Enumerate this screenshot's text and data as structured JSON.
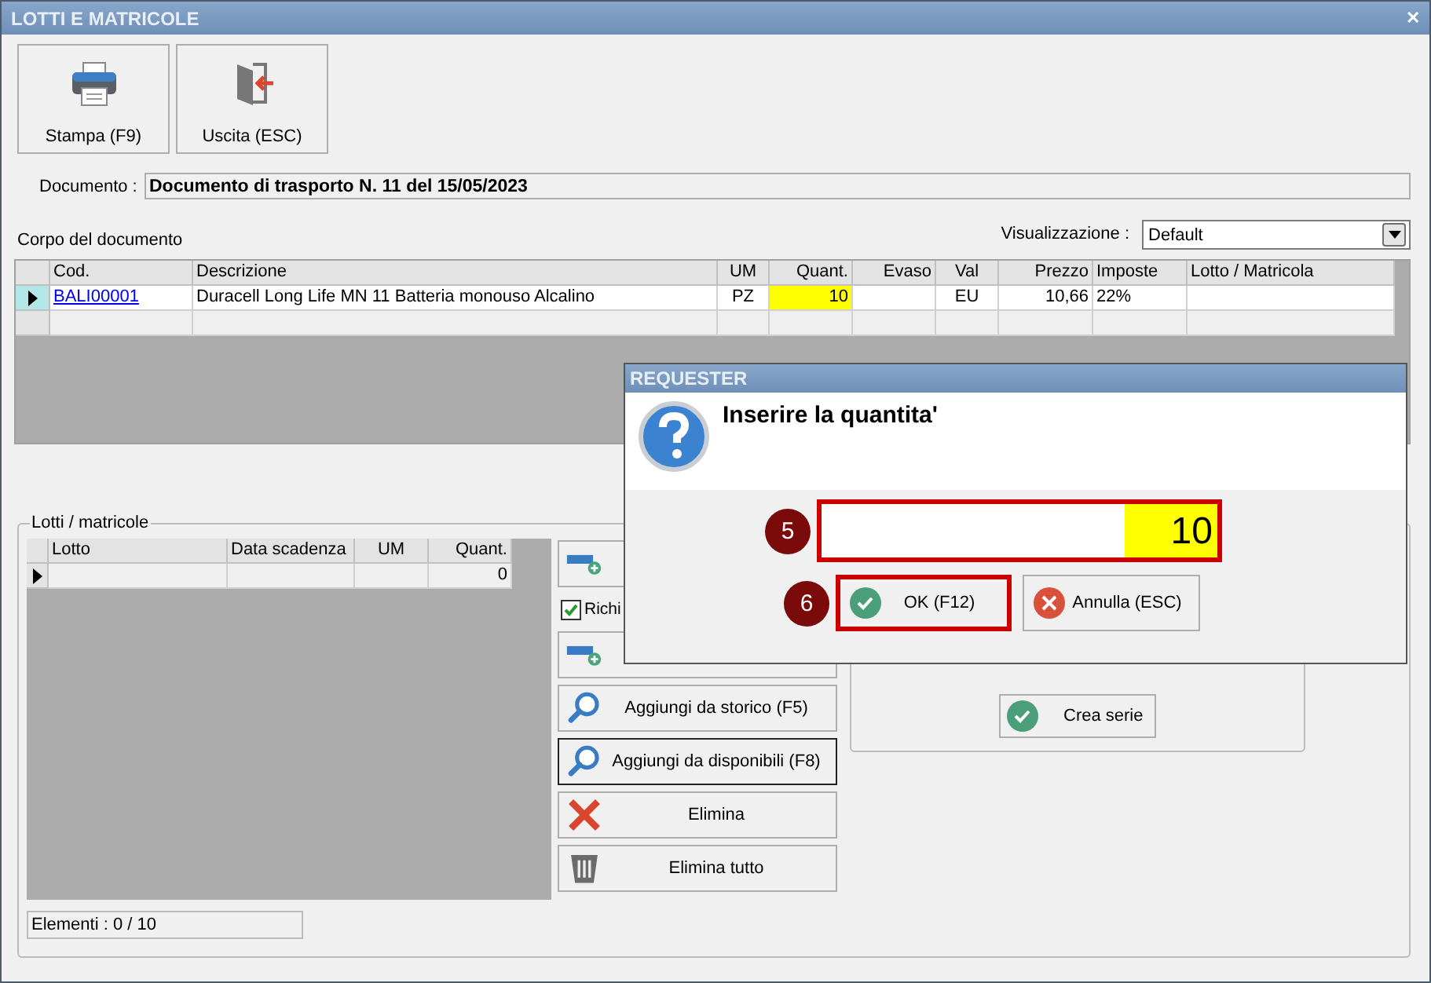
{
  "window": {
    "title": "LOTTI E MATRICOLE",
    "close": "✕"
  },
  "toolbar": [
    {
      "kind": "print",
      "label": "Stampa (F9)"
    },
    {
      "kind": "exit",
      "label": "Uscita (ESC)"
    }
  ],
  "document": {
    "label": "Documento :",
    "value": "Documento di trasporto N. 11 del 15/05/2023"
  },
  "body": {
    "title": "Corpo del documento",
    "view_label": "Visualizzazione :",
    "view_value": "Default",
    "columns": [
      "Cod.",
      "Descrizione",
      "UM",
      "Quant.",
      "Evaso",
      "Val",
      "Prezzo",
      "Imposte",
      "Lotto / Matricola"
    ],
    "rows": [
      {
        "selected": true,
        "quantity_highlighted": true,
        "code": "BALI00001",
        "description": "Duracell Long Life MN 11 Batteria monouso Alcalino",
        "um": "PZ",
        "quantity": "10",
        "val": "EU",
        "price": "10,66",
        "tax": "22%"
      },
      {
        "selected": false,
        "quantity_highlighted": false
      }
    ]
  },
  "lots": {
    "title": "Lotti / matricole",
    "columns": [
      "Lotto",
      "Data scadenza",
      "UM",
      "Quant."
    ],
    "rows": [
      {
        "selected": true,
        "quantity": "0"
      }
    ],
    "status": "Elementi : 0 / 10",
    "actions": [
      {
        "kind": "add",
        "focused": false
      },
      {
        "kind": "checkbox",
        "label": "Richi",
        "checked": true
      },
      {
        "kind": "add",
        "focused": false
      },
      {
        "kind": "search",
        "label": "Aggiungi da storico (F5)",
        "focused": false
      },
      {
        "kind": "search",
        "label": "Aggiungi da disponibili (F8)",
        "focused": true
      },
      {
        "kind": "delete",
        "label": "Elimina",
        "focused": false
      },
      {
        "kind": "trash",
        "label": "Elimina tutto",
        "focused": false
      }
    ],
    "series_button": "Crea serie"
  },
  "dialog": {
    "title": "REQUESTER",
    "message": "Inserire la quantita'",
    "value": "10",
    "value_badge": "5",
    "value_highlighted": true,
    "buttons": [
      {
        "kind": "ok",
        "label": "OK (F12)",
        "highlighted": true,
        "badge": "6"
      },
      {
        "kind": "cancel",
        "label": "Annulla (ESC)",
        "highlighted": false
      }
    ]
  }
}
